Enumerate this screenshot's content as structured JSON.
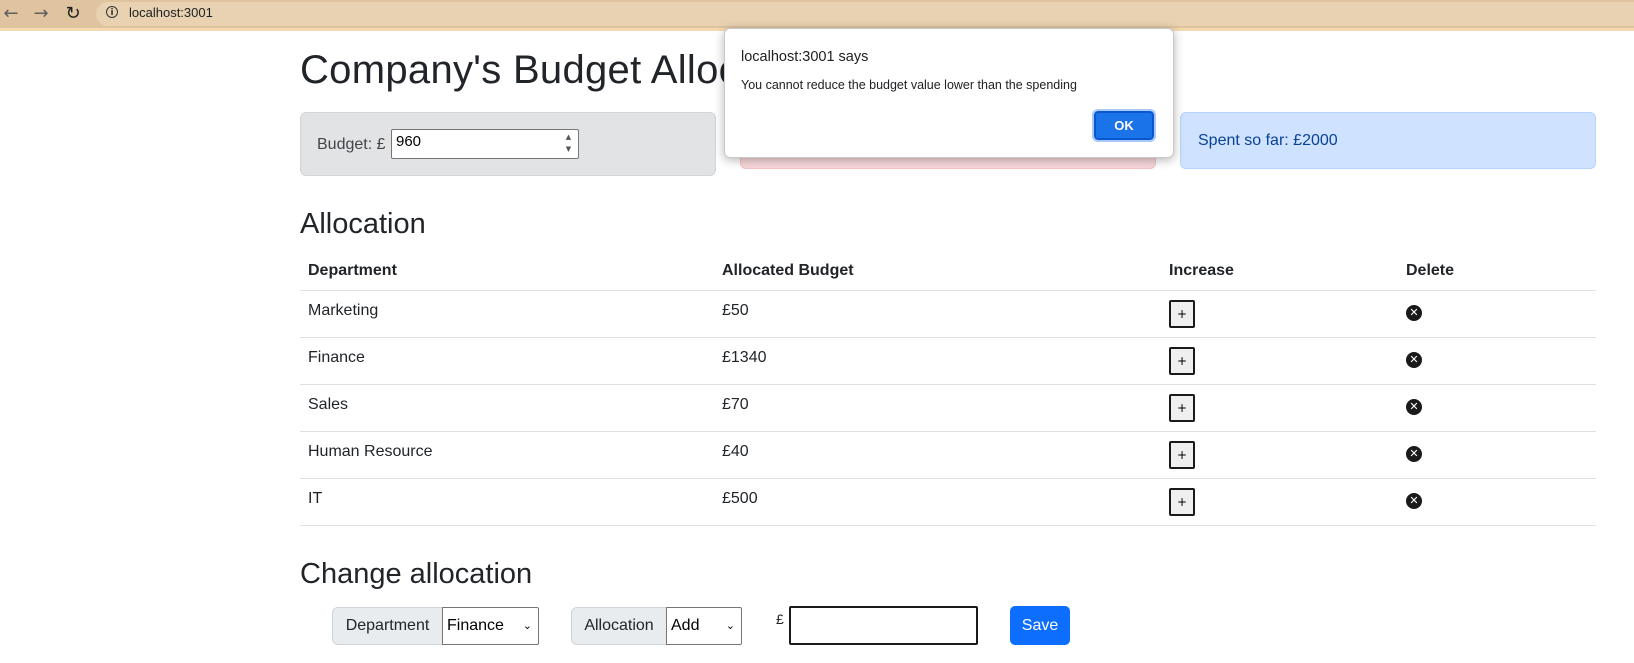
{
  "browser": {
    "url": "localhost:3001",
    "back_icon": "back-arrow-icon",
    "forward_icon": "forward-arrow-icon",
    "reload_icon": "reload-icon",
    "info_icon": "info-icon"
  },
  "header": {
    "title": "Company's Budget Allocation"
  },
  "budget": {
    "label": "Budget: £",
    "value": "960"
  },
  "spent": {
    "text": "Spent so far: £2000"
  },
  "allocation": {
    "title": "Allocation",
    "columns": [
      "Department",
      "Allocated Budget",
      "Increase",
      "Delete"
    ],
    "rows": [
      {
        "department": "Marketing",
        "budget": "£50"
      },
      {
        "department": "Finance",
        "budget": "£1340"
      },
      {
        "department": "Sales",
        "budget": "£70"
      },
      {
        "department": "Human Resource",
        "budget": "£40"
      },
      {
        "department": "IT",
        "budget": "£500"
      }
    ],
    "increase_label": "+",
    "delete_icon": "close-circle-icon"
  },
  "change_allocation": {
    "title": "Change allocation",
    "department_label": "Department",
    "department_value": "Finance",
    "allocation_label": "Allocation",
    "allocation_value": "Add",
    "currency": "£",
    "amount_value": "",
    "save_label": "Save"
  },
  "dialog": {
    "title": "localhost:3001 says",
    "message": "You cannot reduce the budget value lower than the spending",
    "ok_label": "OK"
  },
  "colors": {
    "toolbar": "#dfc49f",
    "primary": "#0d6efd",
    "secondary_bg": "#e2e3e5",
    "danger_bg": "#f8d7da",
    "primary_bg": "#cfe2ff"
  }
}
